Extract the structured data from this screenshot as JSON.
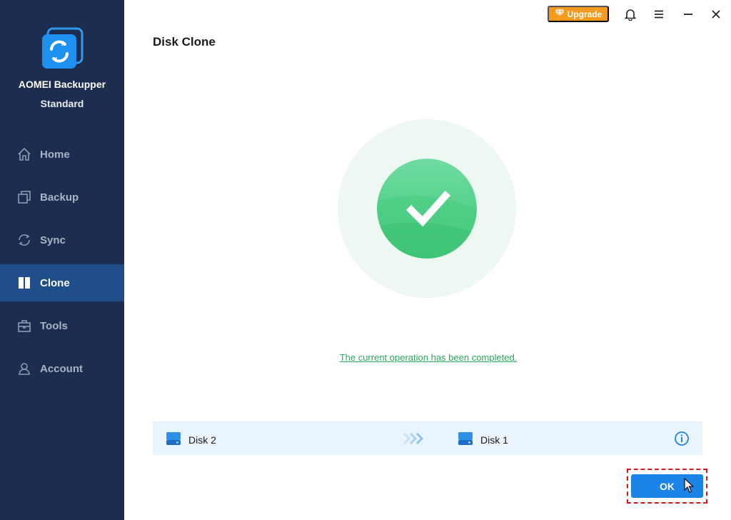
{
  "app": {
    "name": "AOMEI Backupper",
    "edition": "Standard",
    "logo_icon": "sync-disk-logo-icon",
    "colors": {
      "sidebar": "#1c2d4f",
      "active": "#1f4e8a",
      "accent": "#1c84e6",
      "success": "#2aa85a",
      "upgrade": "#f39a1f"
    }
  },
  "sidebar": {
    "items": [
      {
        "label": "Home",
        "icon": "home-icon"
      },
      {
        "label": "Backup",
        "icon": "backup-icon"
      },
      {
        "label": "Sync",
        "icon": "sync-icon"
      },
      {
        "label": "Clone",
        "icon": "clone-icon",
        "active": true
      },
      {
        "label": "Tools",
        "icon": "tools-icon"
      },
      {
        "label": "Account",
        "icon": "account-icon"
      }
    ]
  },
  "topbar": {
    "upgrade_label": "Upgrade",
    "icons": [
      "diamond-icon",
      "bell-icon",
      "menu-icon",
      "minimize-icon",
      "close-icon"
    ]
  },
  "main": {
    "title": "Disk Clone",
    "status_icon": "checkmark-icon",
    "status_text": "The current operation has been completed.",
    "disk_bar": {
      "source": "Disk 2",
      "destination": "Disk 1",
      "icons": [
        "disk-icon",
        "arrows-right-icon",
        "info-icon"
      ]
    },
    "ok_label": "OK"
  }
}
